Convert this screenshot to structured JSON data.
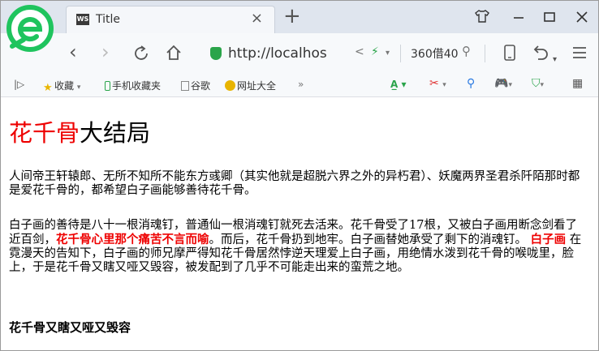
{
  "browser": {
    "tab_title": "Title",
    "tab_favicon": "WS",
    "address": "http://localhos",
    "search_text": "360借40",
    "accent": "#2aa44a",
    "logo_color": "#1fc45e"
  },
  "bookmarks": [
    "收藏",
    "手机收藏夹",
    "谷歌",
    "网址大全"
  ],
  "article": {
    "title_red": "花千骨",
    "title_rest": "大结局",
    "p1": "人间帝王轩辕郎、无所不知所不能东方彧卿（其实他就是超脱六界之外的异朽君）、妖魔两界圣君杀阡陌那时都是爱花千骨的，都希望白子画能够善待花千骨。",
    "p2_a": "白子画的善待是八十一根消魂钉，普通仙一根消魂钉就死去活来。花千骨受了17根，又被白子画用断念剑看了近百剑，",
    "p2_strong1": "花千骨心里那个痛苦不言而喻",
    "p2_b": "。而后，花千骨扔到地牢。白子画替她承受了剩下的消魂钉。",
    "p2_strong2": "白子画",
    "p2_c": "在霓漫天的告知下，白子画的师兄摩严得知花千骨居然悖逆天理爱上白子画，用绝情水泼到花千骨的喉咙里，脸上，于是花千骨又瞎又哑又毁容，被发配到了几乎不可能走出来的蛮荒之地。",
    "subtitle": "花千骨又瞎又哑又毁容",
    "red_color": "#e00000"
  }
}
